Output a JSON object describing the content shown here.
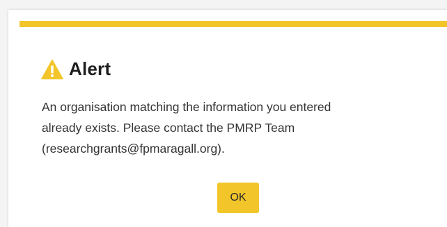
{
  "dialog": {
    "title": "Alert",
    "icon": "warning-triangle-icon",
    "message_lines": [
      "An organisation matching the information you entered",
      "already exists. Please contact the PMRP Team",
      "(researchgrants@fpmaragall.org)."
    ],
    "ok_label": "OK"
  },
  "colors": {
    "accent": "#f2c62a",
    "text": "#333333",
    "title": "#1e1e1e"
  }
}
